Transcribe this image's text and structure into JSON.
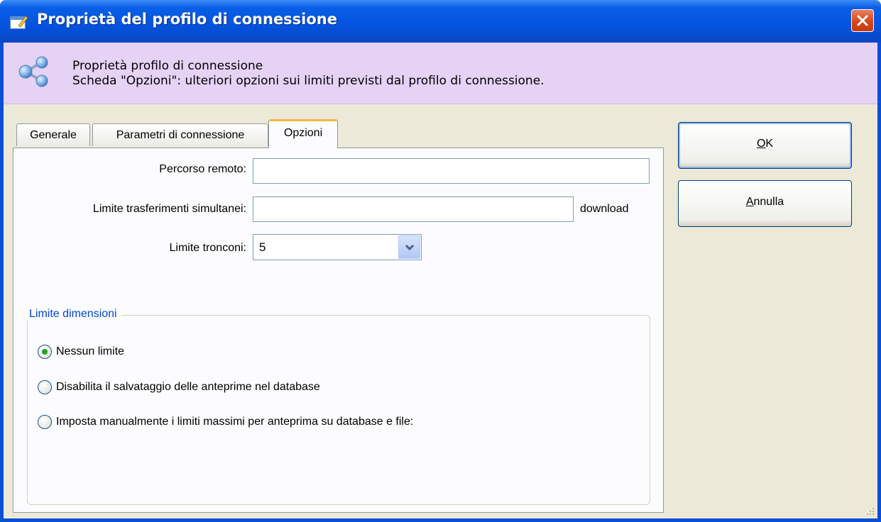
{
  "window": {
    "title": "Proprietà del profilo di connessione"
  },
  "header": {
    "title": "Proprietà profilo di connessione",
    "subtitle": "Scheda \"Opzioni\": ulteriori opzioni sui limiti previsti dal profilo di connessione."
  },
  "tabs": [
    {
      "label": "Generale"
    },
    {
      "label": "Parametri di connessione"
    },
    {
      "label": "Opzioni",
      "active": true
    }
  ],
  "form": {
    "remote_path_label": "Percorso remoto:",
    "remote_path_value": "",
    "transfer_limit_label": "Limite trasferimenti simultanei:",
    "transfer_limit_value": "",
    "transfer_limit_unit": "download",
    "chunk_limit_label": "Limite tronconi:",
    "chunk_limit_value": "5"
  },
  "size_limits": {
    "title": "Limite dimensioni",
    "options": [
      {
        "label": "Nessun limite",
        "selected": true
      },
      {
        "label": "Disabilita il salvataggio delle anteprime nel database",
        "selected": false
      },
      {
        "label": "Imposta manualmente i limiti massimi per  anteprima su database e file:",
        "selected": false
      }
    ]
  },
  "buttons": {
    "ok_mnemonic": "O",
    "ok_rest": "K",
    "cancel_mnemonic": "A",
    "cancel_rest": "nnulla"
  },
  "colors": {
    "title_bar": "#0553de",
    "header_band": "#e6d2f5",
    "dialog_bg": "#ece9d8",
    "group_title": "#0046d5",
    "tab_highlight": "#f7b943"
  }
}
